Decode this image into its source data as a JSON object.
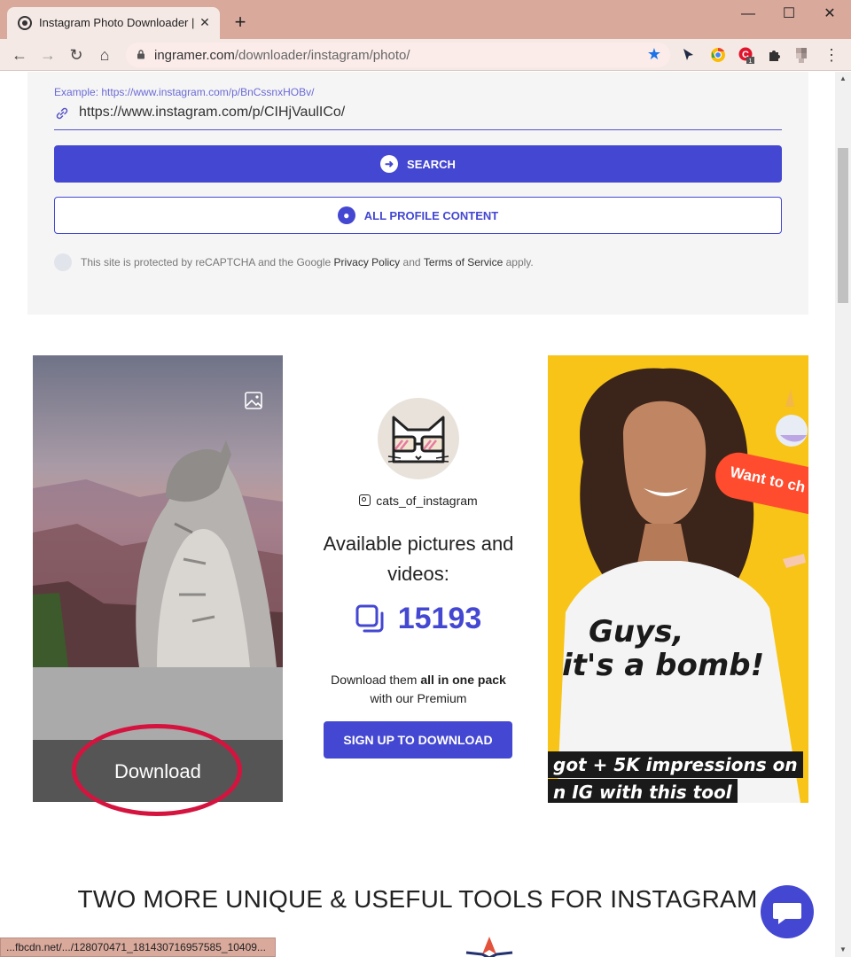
{
  "browser": {
    "tab_title": "Instagram Photo Downloader |",
    "url_host": "ingramer.com",
    "url_path": "/downloader/instagram/photo/",
    "status_url": "...fbcdn.net/.../128070471_181430716957585_10409..."
  },
  "search": {
    "example_label": "Example: https://www.instagram.com/p/BnCssnxHOBv/",
    "input_value": "https://www.instagram.com/p/CIHjVaulICo/",
    "search_button": "SEARCH",
    "profile_button": "ALL PROFILE CONTENT",
    "recaptcha_prefix": "This site is protected by reCAPTCHA and the Google",
    "privacy_link": "Privacy Policy",
    "and": "and",
    "terms_link": "Terms of Service",
    "apply": "apply."
  },
  "result": {
    "download_label": "Download",
    "username": "cats_of_instagram",
    "available_title": "Available pictures and videos:",
    "count": "15193",
    "pack_text_prefix": "Download them",
    "pack_text_bold": "all in one pack",
    "pack_text_suffix": "with our Premium",
    "signup_button": "SIGN UP TO DOWNLOAD"
  },
  "ad": {
    "pill_text": "Want to ch",
    "line1": "Guys,",
    "line2": "it's a bomb!",
    "line3": "got + 5K impressions on",
    "line4": "n IG with this tool"
  },
  "tools_heading": "TWO MORE UNIQUE & USEFUL TOOLS FOR INSTAGRAM",
  "colors": {
    "brand": "#4447d1",
    "annotation": "#d4143f",
    "ad_background": "#f7c417"
  }
}
